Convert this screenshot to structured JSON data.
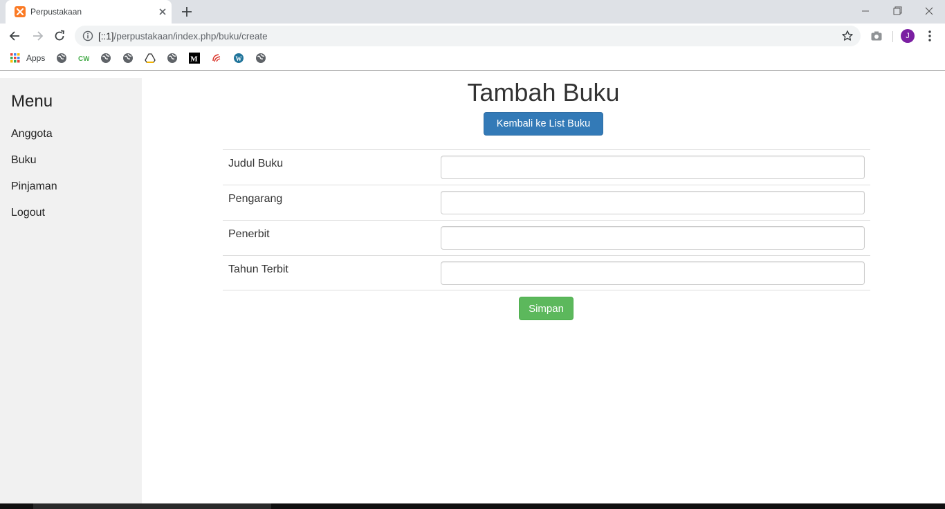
{
  "browser": {
    "tab_title": "Perpustakaan",
    "url_host": "[::1]",
    "url_path": "/perpustakaan/index.php/buku/create",
    "avatar_letter": "J",
    "bookmarks_apps_label": "Apps",
    "bookmark_icons": [
      "globe-icon",
      "cw-icon",
      "globe-icon",
      "globe-icon",
      "drive-icon",
      "globe-icon",
      "medium-icon",
      "swirl-icon",
      "wordpress-icon",
      "globe-icon"
    ]
  },
  "sidebar": {
    "title": "Menu",
    "items": [
      {
        "label": "Anggota"
      },
      {
        "label": "Buku"
      },
      {
        "label": "Pinjaman"
      },
      {
        "label": "Logout"
      }
    ]
  },
  "main": {
    "title": "Tambah Buku",
    "back_button": "Kembali ke List Buku",
    "fields": [
      {
        "label": "Judul Buku",
        "value": ""
      },
      {
        "label": "Pengarang",
        "value": ""
      },
      {
        "label": "Penerbit",
        "value": ""
      },
      {
        "label": "Tahun Terbit",
        "value": ""
      }
    ],
    "save_button": "Simpan"
  },
  "colors": {
    "primary_button": "#337ab7",
    "success_button": "#5cb85c",
    "sidebar_bg": "#f1f1f1",
    "avatar": "#7b1fa2"
  }
}
